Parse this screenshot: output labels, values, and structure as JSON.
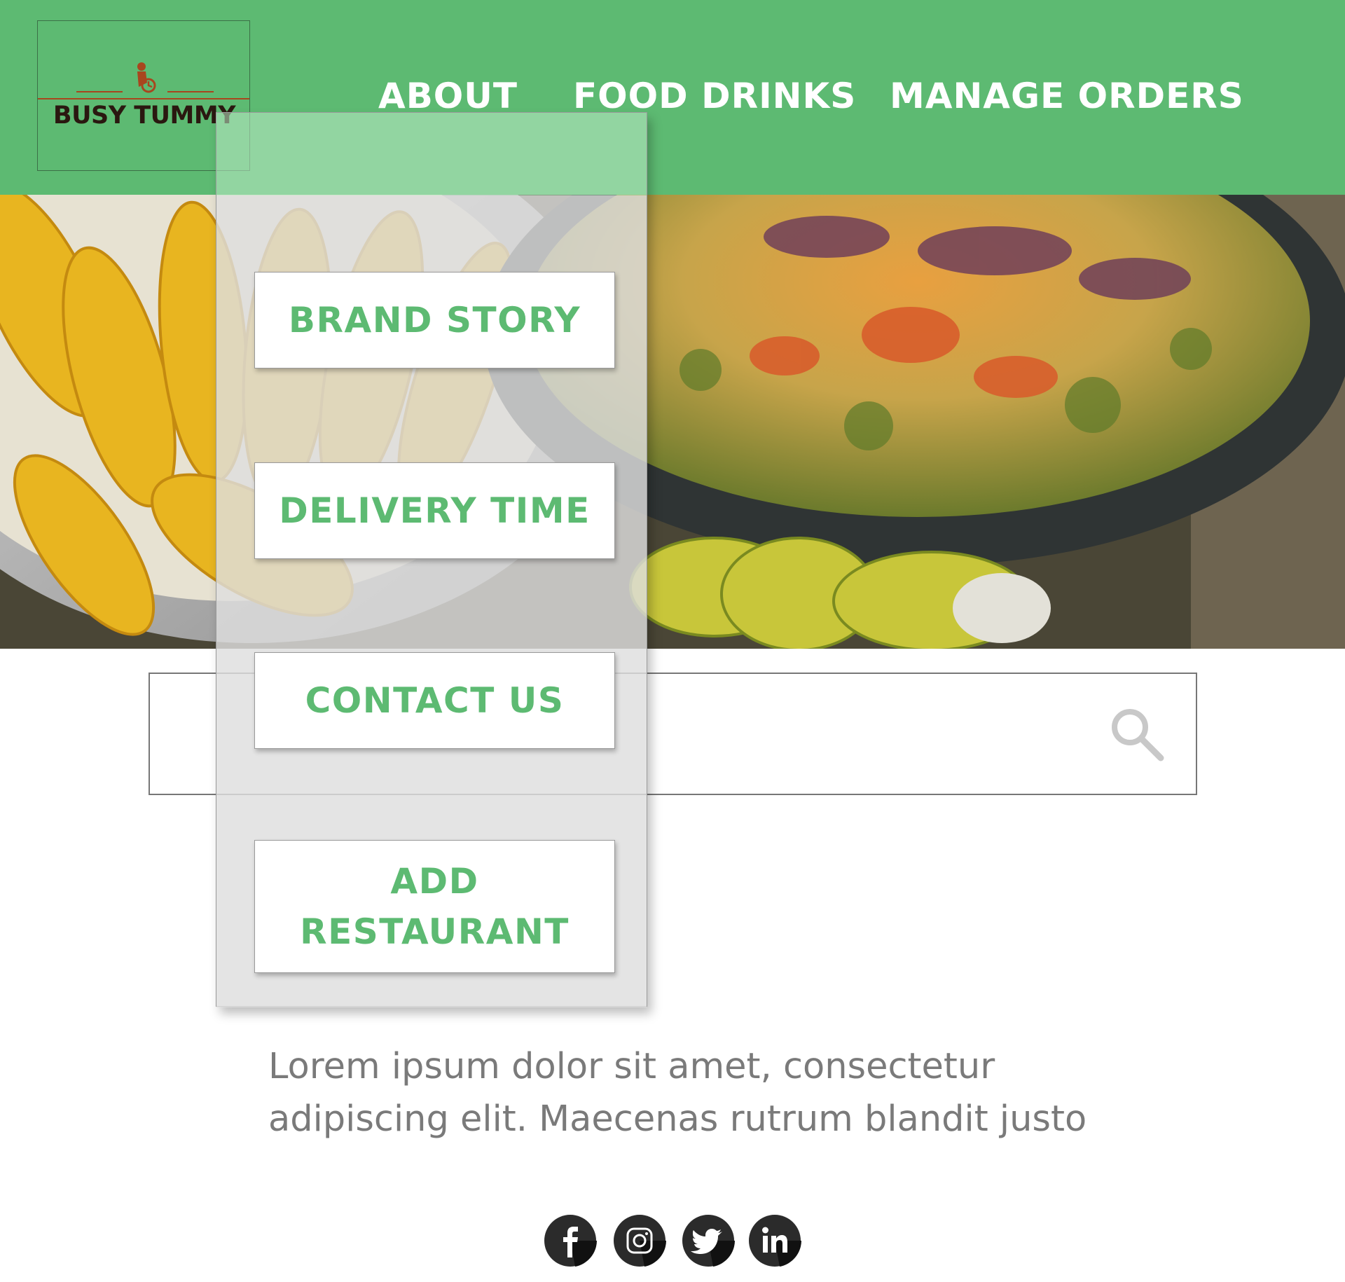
{
  "header": {
    "logo_text": "BUSY TUMMY",
    "nav": [
      "ABOUT",
      "FOOD DRINKS",
      "MANAGE ORDERS"
    ]
  },
  "search": {
    "placeholder": "",
    "value": ""
  },
  "dropdown": {
    "items": [
      "BRAND STORY",
      "DELIVERY TIME",
      "CONTACT US",
      "ADD RESTAURANT"
    ]
  },
  "body_text": "Lorem ipsum dolor sit amet, consectetur adipiscing elit. Maecenas rutrum blandit justo",
  "social": [
    "facebook-icon",
    "instagram-icon",
    "twitter-icon",
    "linkedin-icon"
  ],
  "colors": {
    "brand_green": "#5dba72",
    "logo_text": "#2a1810",
    "logo_accent": "#a8461e"
  }
}
